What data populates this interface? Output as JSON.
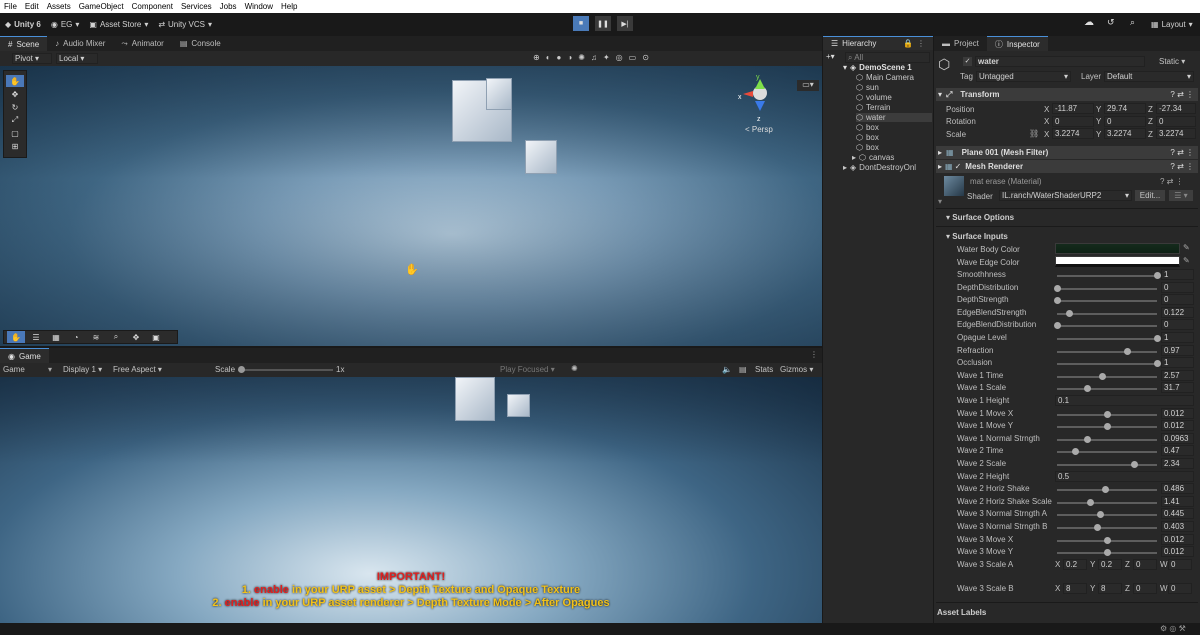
{
  "menu": [
    "File",
    "Edit",
    "Assets",
    "GameObject",
    "Component",
    "Services",
    "Jobs",
    "Window",
    "Help"
  ],
  "toolbar": {
    "unity": "Unity 6",
    "account": "EG",
    "asset_store": "Asset Store",
    "vcs": "Unity VCS",
    "layout": "Layout"
  },
  "scene_tabs": [
    "Scene",
    "Audio Mixer",
    "Animator",
    "Console"
  ],
  "scene_toolbar": {
    "pivot": "Pivot",
    "local": "Local"
  },
  "gizmo": {
    "persp": "< Persp",
    "y": "y",
    "x": "x",
    "z": "z"
  },
  "game": {
    "tab": "Game",
    "mode": "Game",
    "display": "Display 1",
    "aspect": "Free Aspect",
    "scale_label": "Scale",
    "scale_value": "1x",
    "play_focused": "Play Focused",
    "stats": "Stats",
    "gizmos": "Gizmos"
  },
  "overlay": {
    "important": "IMPORTANT!",
    "line1_num": "1.",
    "line1_enable": "enable",
    "line1_rest": "in your URP asset > Depth Texture and Opaque Texture",
    "line2_num": "2.",
    "line2_enable": "enable",
    "line2_rest": "in your URP asset renderer > Depth Texture Mode > After Opagues"
  },
  "hierarchy": {
    "tab": "Hierarchy",
    "search": "All",
    "scene": "DemoScene 1",
    "items": [
      "Main Camera",
      "sun",
      "volume",
      "Terrain",
      "water",
      "box",
      "box",
      "box",
      "canvas"
    ],
    "dont_destroy": "DontDestroyOnl"
  },
  "project_tab": "Project",
  "inspector": {
    "tab": "Inspector",
    "name": "water",
    "static": "Static",
    "tag_label": "Tag",
    "tag": "Untagged",
    "layer_label": "Layer",
    "layer": "Default",
    "transform": "Transform",
    "position": {
      "label": "Position",
      "x": "-11.87",
      "y": "29.74",
      "z": "-27.34"
    },
    "rotation": {
      "label": "Rotation",
      "x": "0",
      "y": "0",
      "z": "0"
    },
    "scale": {
      "label": "Scale",
      "x": "3.2274",
      "y": "3.2274",
      "z": "3.2274"
    },
    "mesh_filter": "Plane 001 (Mesh Filter)",
    "mesh_renderer": "Mesh Renderer",
    "material": "mat erase (Material)",
    "shader_label": "Shader",
    "shader": "IL.ranch/WaterShaderURP2",
    "edit": "Edit...",
    "surface_options": "Surface Options",
    "surface_inputs": "Surface Inputs",
    "color_props": [
      {
        "label": "Water Body Color"
      },
      {
        "label": "Wave Edge Color"
      }
    ],
    "sliders": [
      {
        "label": "Smoothhness",
        "value": "1",
        "level": 1.0
      },
      {
        "label": "DepthDistribution",
        "value": "0",
        "level": 0.0
      },
      {
        "label": "DepthStrength",
        "value": "0",
        "level": 0.0
      },
      {
        "label": "EdgeBlendStrength",
        "value": "0.122",
        "level": 0.12
      },
      {
        "label": "EdgeBlendDistribution",
        "value": "0",
        "level": 0.0
      },
      {
        "label": "Opague Level",
        "value": "1",
        "level": 1.0
      },
      {
        "label": "Refraction",
        "value": "0.97",
        "level": 0.7
      },
      {
        "label": "Occlusion",
        "value": "1",
        "level": 1.0
      },
      {
        "label": "Wave 1 Time",
        "value": "2.57",
        "level": 0.45
      },
      {
        "label": "Wave 1 Scale",
        "value": "31.7",
        "level": 0.3
      }
    ],
    "wave1_height": {
      "label": "Wave 1 Height",
      "value": "0.1"
    },
    "sliders2": [
      {
        "label": "Wave 1 Move X",
        "value": "0.012",
        "level": 0.5
      },
      {
        "label": "Wave 1 Move Y",
        "value": "0.012",
        "level": 0.5
      },
      {
        "label": "Wave 1 Normal Strngth",
        "value": "0.0963",
        "level": 0.3
      },
      {
        "label": "Wave 2 Time",
        "value": "0.47",
        "level": 0.18
      },
      {
        "label": "Wave 2 Scale",
        "value": "2.34",
        "level": 0.77
      }
    ],
    "wave2_height": {
      "label": "Wave 2 Height",
      "value": "0.5"
    },
    "sliders3": [
      {
        "label": "Wave 2 Horiz Shake",
        "value": "0.486",
        "level": 0.48
      },
      {
        "label": "Wave 2 Horiz Shake Scale",
        "value": "1.41",
        "level": 0.33
      },
      {
        "label": "Wave 3 Normal Strngth A",
        "value": "0.445",
        "level": 0.43
      },
      {
        "label": "Wave 3 Normal Strngth B",
        "value": "0.403",
        "level": 0.4
      },
      {
        "label": "Wave 3 Move X",
        "value": "0.012",
        "level": 0.5
      },
      {
        "label": "Wave 3 Move Y",
        "value": "0.012",
        "level": 0.5
      }
    ],
    "wave3_scale_a": {
      "label": "Wave 3 Scale A",
      "x": "0.2",
      "y": "0.2",
      "z": "0",
      "w": "0"
    },
    "wave3_scale_b": {
      "label": "Wave 3 Scale B",
      "x": "8",
      "y": "8",
      "z": "0",
      "w": "0"
    },
    "asset_labels": "Asset Labels"
  }
}
